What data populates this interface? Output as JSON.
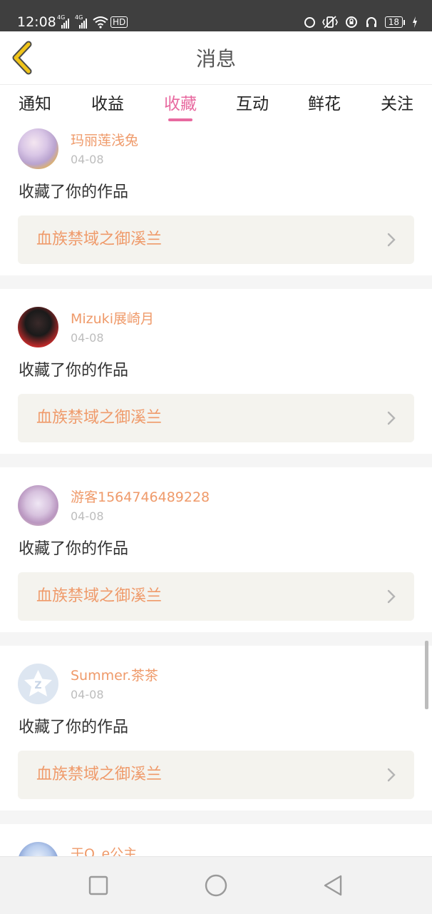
{
  "status_bar": {
    "time": "12:08",
    "signal_labels": [
      "4G",
      "4G"
    ],
    "hd_label": "HD",
    "battery_level": "18",
    "icons": [
      "wifi-icon",
      "vibrate-icon",
      "alarm-icon",
      "headphones-icon",
      "charging-icon"
    ]
  },
  "header": {
    "title": "消息",
    "back_icon": "chevron-left-icon"
  },
  "tabs": [
    {
      "label": "通知",
      "active": false
    },
    {
      "label": "收益",
      "active": false
    },
    {
      "label": "收藏",
      "active": true
    },
    {
      "label": "互动",
      "active": false
    },
    {
      "label": "鲜花",
      "active": false
    },
    {
      "label": "关注",
      "active": false
    }
  ],
  "messages": [
    {
      "username": "玛丽莲浅兔",
      "date": "04-08",
      "action": "收藏了你的作品",
      "work_title": "血族禁域之御溪兰"
    },
    {
      "username": "Mizuki展崎月",
      "date": "04-08",
      "action": "收藏了你的作品",
      "work_title": "血族禁域之御溪兰"
    },
    {
      "username": "游客1564746489228",
      "date": "04-08",
      "action": "收藏了你的作品",
      "work_title": "血族禁域之御溪兰"
    },
    {
      "username": "Summer.茶茶",
      "date": "04-08",
      "action": "收藏了你的作品",
      "work_title": "血族禁域之御溪兰"
    },
    {
      "username": "于Q_e公主",
      "date": "",
      "action": "",
      "work_title": ""
    }
  ],
  "nav_bar": {
    "buttons": [
      "recent-apps-icon",
      "home-icon",
      "back-triangle-icon"
    ]
  },
  "colors": {
    "accent_pink": "#e86aa0",
    "username_orange": "#ef9a6a",
    "link_bg": "#f4f3ee",
    "back_arrow_yellow": "#f0c419"
  }
}
